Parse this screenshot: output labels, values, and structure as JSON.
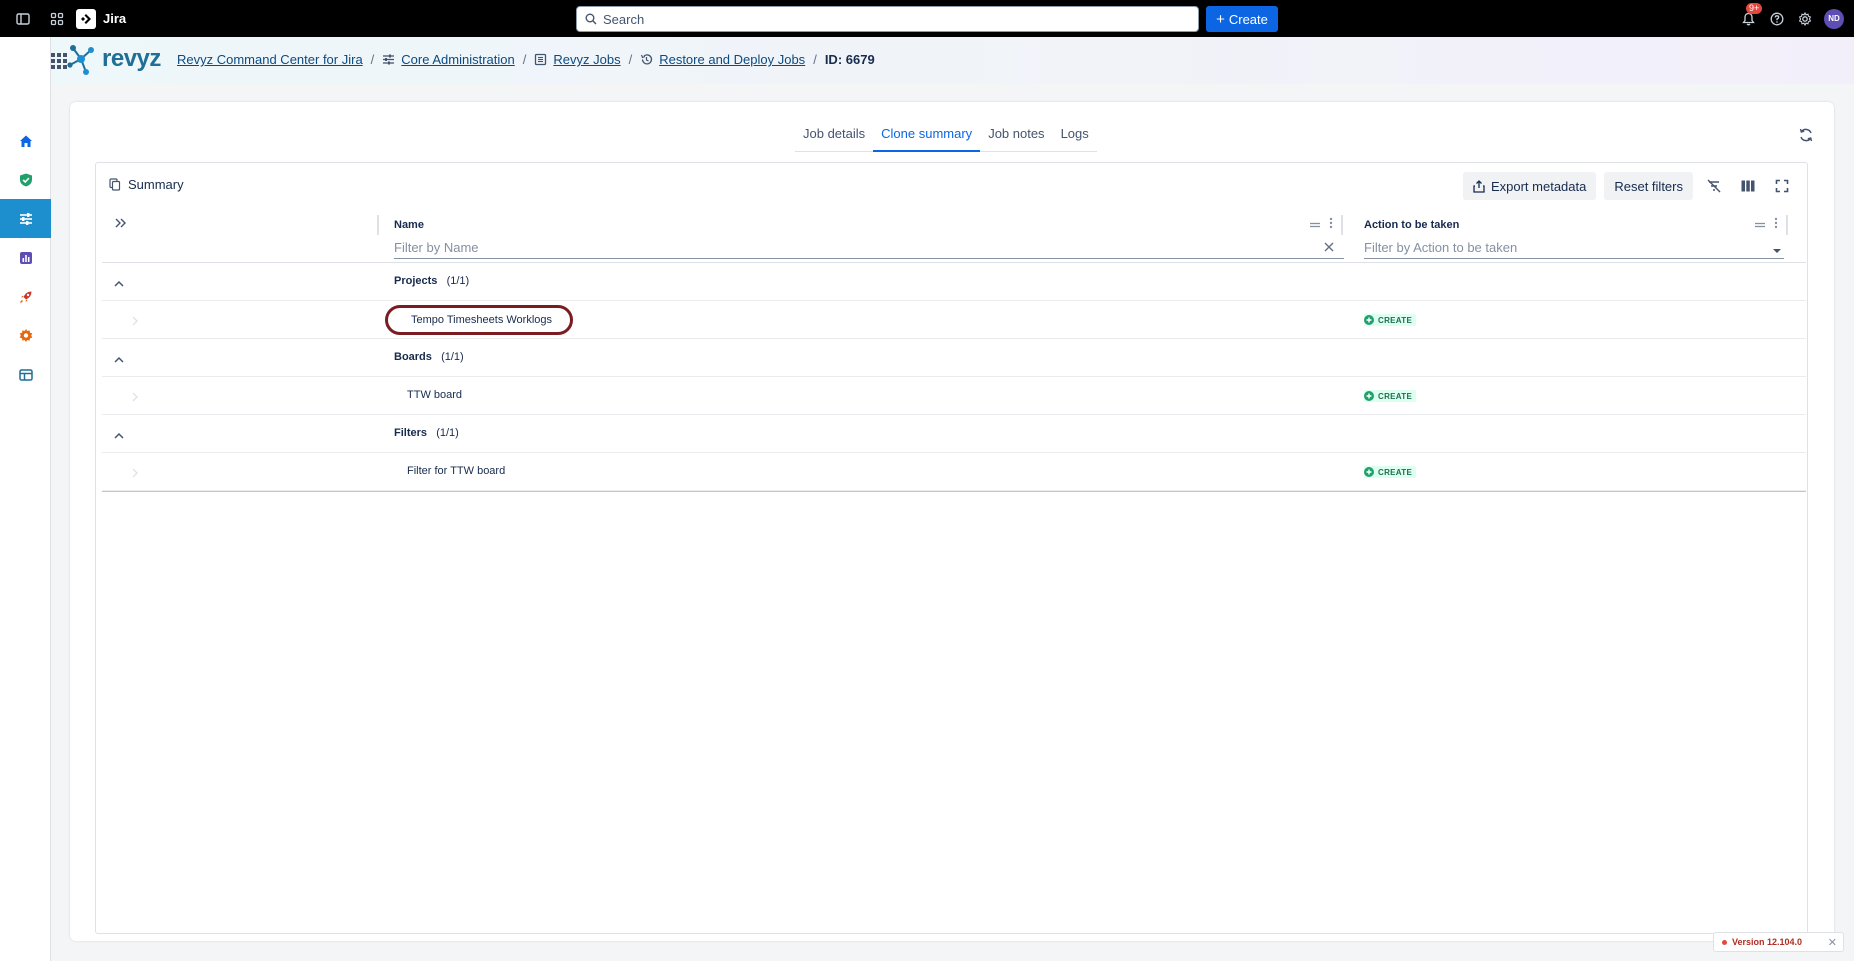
{
  "topbar": {
    "app_name": "Jira",
    "search_placeholder": "Search",
    "create_label": "Create",
    "notification_count": "9+",
    "avatar_initials": "ND"
  },
  "brand": {
    "logo_text": "revyz"
  },
  "breadcrumb": {
    "items": [
      "Revyz Command Center for Jira",
      "Core Administration",
      "Revyz Jobs",
      "Restore and Deploy Jobs"
    ],
    "current": "ID: 6679",
    "separator": "/"
  },
  "tabs": [
    "Job details",
    "Clone summary",
    "Job notes",
    "Logs"
  ],
  "active_tab": "Clone summary",
  "summary": {
    "title": "Summary",
    "export_label": "Export metadata",
    "reset_label": "Reset filters"
  },
  "table": {
    "columns": {
      "name": {
        "label": "Name",
        "filter_placeholder": "Filter by Name"
      },
      "action": {
        "label": "Action to be taken",
        "filter_placeholder": "Filter by Action to be taken"
      }
    },
    "groups": [
      {
        "label": "Projects",
        "count": "(1/1)",
        "items": [
          {
            "name": "Tempo Timesheets Worklogs",
            "action": "CREATE"
          }
        ]
      },
      {
        "label": "Boards",
        "count": "(1/1)",
        "items": [
          {
            "name": "TTW board",
            "action": "CREATE"
          }
        ]
      },
      {
        "label": "Filters",
        "count": "(1/1)",
        "items": [
          {
            "name": "Filter for TTW board",
            "action": "CREATE"
          }
        ]
      }
    ]
  },
  "version": "Version 12.104.0",
  "colors": {
    "primary": "#0c66e4",
    "rail_active": "#1d8fcf",
    "create_badge": "#216e4e",
    "highlight_ring": "#7a1c22"
  }
}
